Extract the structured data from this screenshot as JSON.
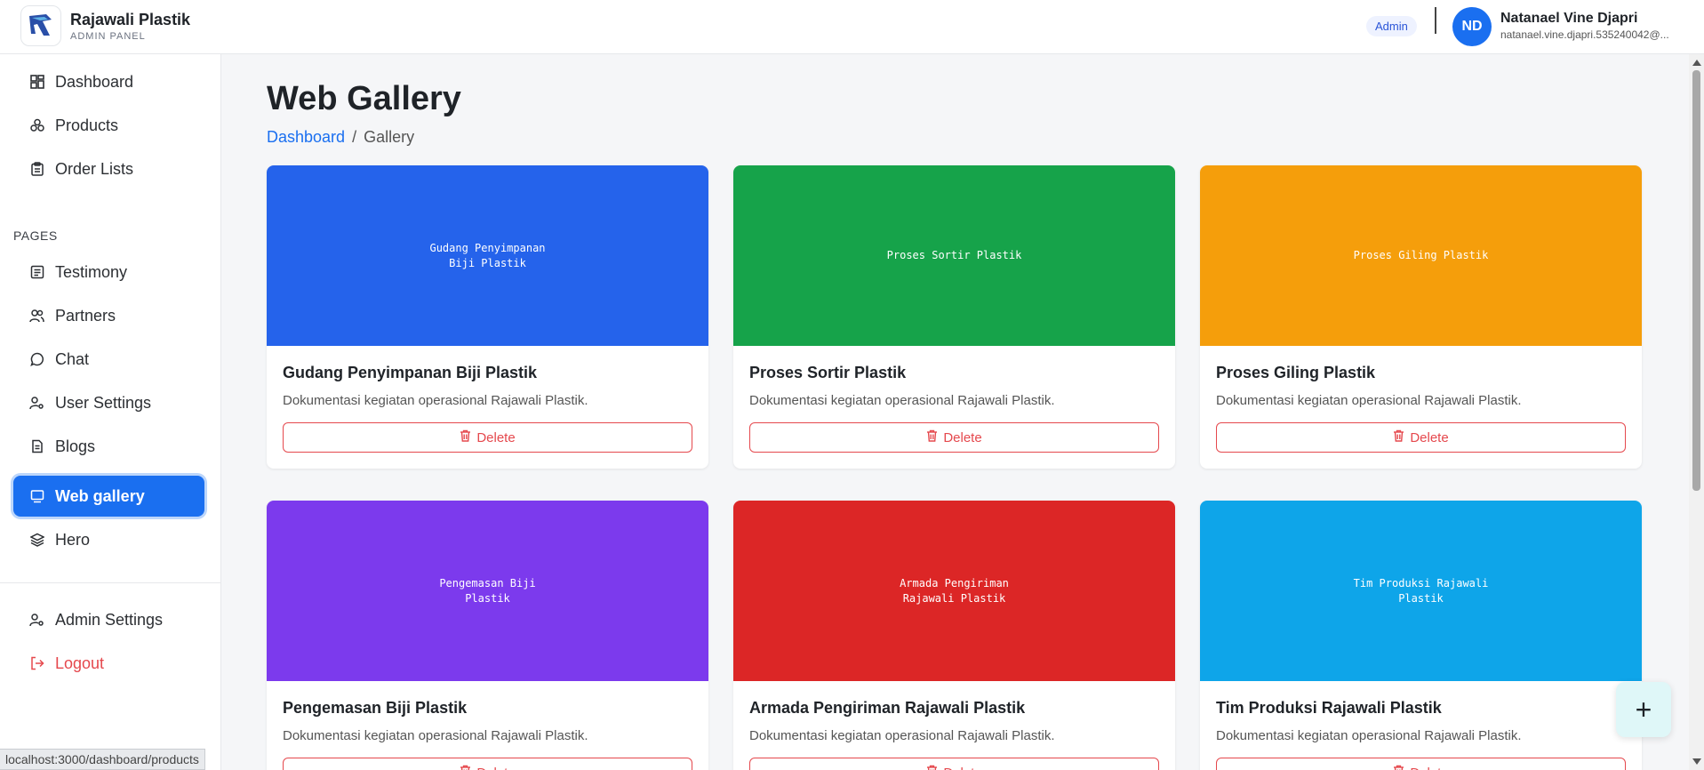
{
  "header": {
    "brand_name": "Rajawali Plastik",
    "brand_sub": "ADMIN PANEL",
    "role": "Admin",
    "avatar_initials": "ND",
    "user_name": "Natanael Vine Djapri",
    "user_email": "natanael.vine.djapri.535240042@..."
  },
  "sidebar": {
    "main_items": [
      {
        "label": "Dashboard",
        "icon": "dashboard-grid-icon"
      },
      {
        "label": "Products",
        "icon": "boxes-icon"
      },
      {
        "label": "Order Lists",
        "icon": "clipboard-icon"
      }
    ],
    "section_label": "PAGES",
    "page_items": [
      {
        "label": "Testimony",
        "icon": "message-square-icon"
      },
      {
        "label": "Partners",
        "icon": "users-icon"
      },
      {
        "label": "Chat",
        "icon": "chat-bubble-icon"
      },
      {
        "label": "User Settings",
        "icon": "user-cog-icon"
      },
      {
        "label": "Blogs",
        "icon": "file-text-icon"
      },
      {
        "label": "Web gallery",
        "icon": "monitor-icon",
        "active": true
      },
      {
        "label": "Hero",
        "icon": "layers-icon"
      }
    ],
    "bottom_items": [
      {
        "label": "Admin Settings",
        "icon": "user-cog-icon"
      },
      {
        "label": "Logout",
        "icon": "logout-icon"
      }
    ]
  },
  "main": {
    "title": "Web Gallery",
    "breadcrumb": {
      "link": "Dashboard",
      "separator": "/",
      "current": "Gallery"
    },
    "delete_label": "Delete",
    "cards": [
      {
        "image_text": "Gudang Penyimpanan\nBiji Plastik",
        "color": "#2563eb",
        "title": "Gudang Penyimpanan Biji Plastik",
        "description": "Dokumentasi kegiatan operasional Rajawali Plastik."
      },
      {
        "image_text": "Proses Sortir Plastik",
        "color": "#16a34a",
        "title": "Proses Sortir Plastik",
        "description": "Dokumentasi kegiatan operasional Rajawali Plastik."
      },
      {
        "image_text": "Proses Giling Plastik",
        "color": "#f59e0b",
        "title": "Proses Giling Plastik",
        "description": "Dokumentasi kegiatan operasional Rajawali Plastik."
      },
      {
        "image_text": "Pengemasan Biji\nPlastik",
        "color": "#7c3aed",
        "title": "Pengemasan Biji Plastik",
        "description": "Dokumentasi kegiatan operasional Rajawali Plastik."
      },
      {
        "image_text": "Armada Pengiriman\nRajawali Plastik",
        "color": "#dc2626",
        "title": "Armada Pengiriman Rajawali Plastik",
        "description": "Dokumentasi kegiatan operasional Rajawali Plastik."
      },
      {
        "image_text": "Tim Produksi Rajawali\nPlastik",
        "color": "#0ea5e9",
        "title": "Tim Produksi Rajawali Plastik",
        "description": "Dokumentasi kegiatan operasional Rajawali Plastik."
      }
    ]
  },
  "fab": {
    "label": "+"
  },
  "status_url": "localhost:3000/dashboard/products"
}
